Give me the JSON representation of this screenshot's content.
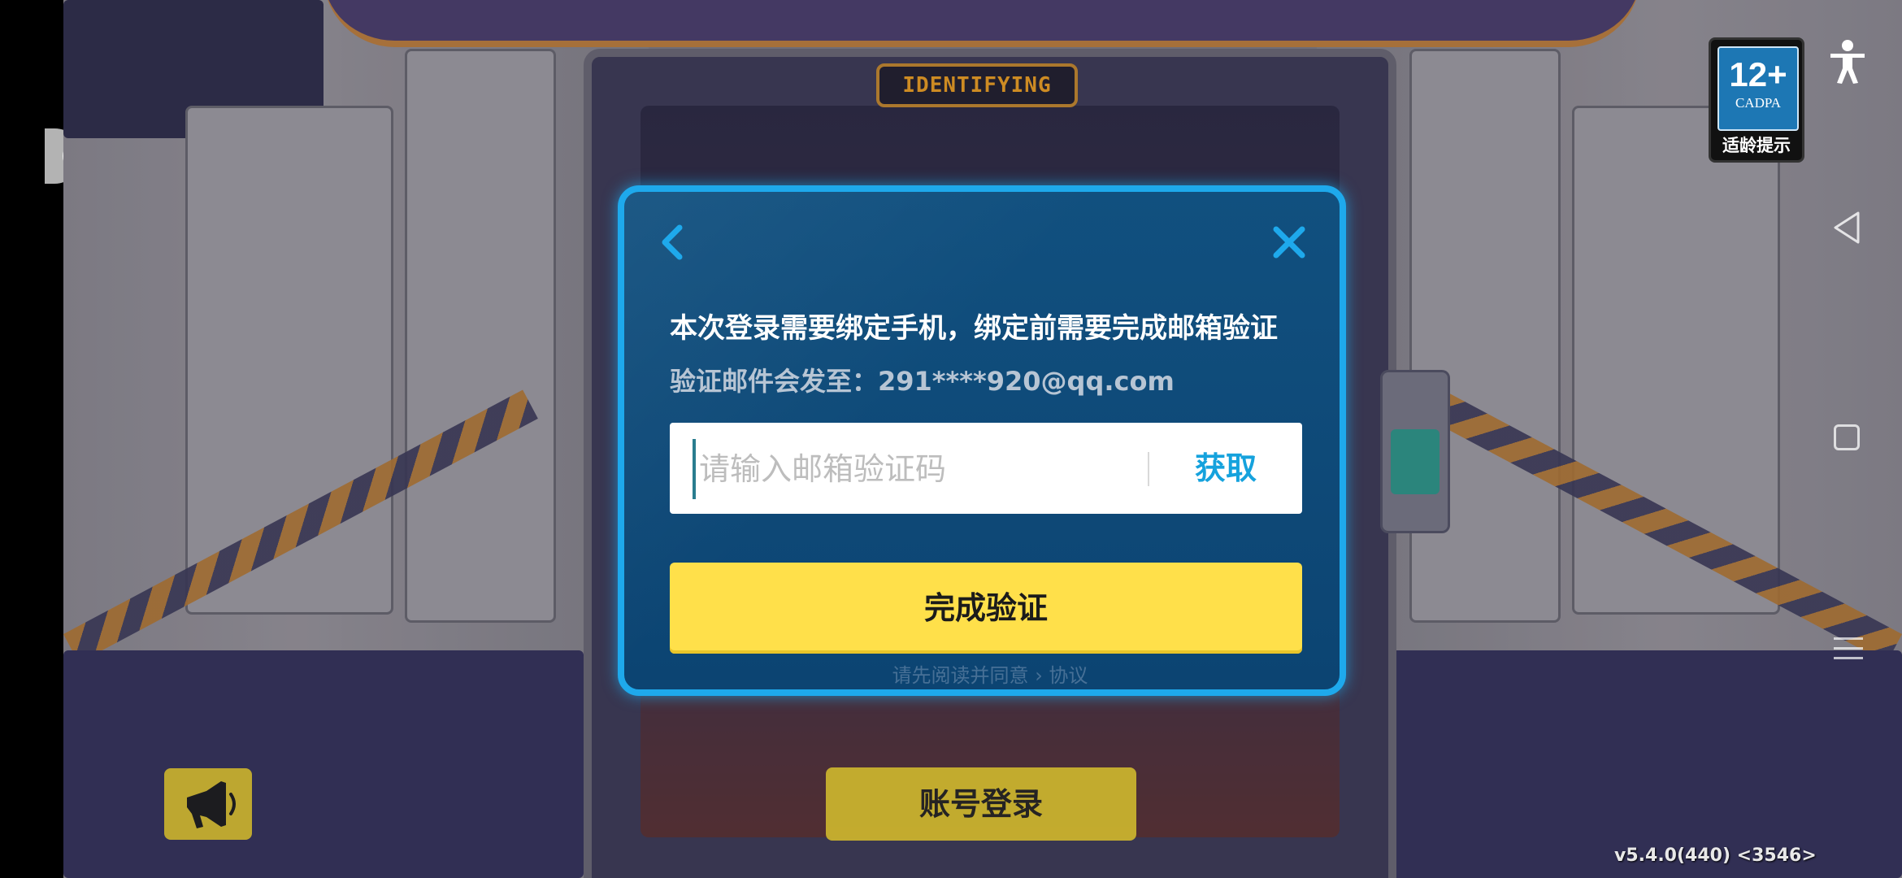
{
  "badge": {
    "rating": "12+",
    "org": "CADPA",
    "hint": "适龄提示"
  },
  "background": {
    "sign_text": "IDENTIFYING"
  },
  "dialog": {
    "title": "本次登录需要绑定手机，绑定前需要完成邮箱验证",
    "subtitle": "验证邮件会发至：291****920@qq.com",
    "code_placeholder": "请输入邮箱验证码",
    "code_value": "",
    "get_code_label": "获取",
    "confirm_label": "完成验证",
    "faint_text": "请先阅读并同意 › 协议"
  },
  "bottom": {
    "account_login_label": "账号登录",
    "version": "v5.4.0(440) <3546>"
  },
  "icons": {
    "back": "chevron-left-icon",
    "close": "close-icon",
    "sound": "megaphone-icon",
    "accessibility": "accessibility-icon",
    "nav_back": "triangle-back-icon",
    "nav_home": "square-home-icon",
    "nav_menu": "hamburger-menu-icon"
  },
  "colors": {
    "dialog_bg": "#0f4a7c",
    "dialog_border": "#1ea9ec",
    "confirm_bg": "#ffe04a",
    "get_code": "#15a2dd"
  }
}
